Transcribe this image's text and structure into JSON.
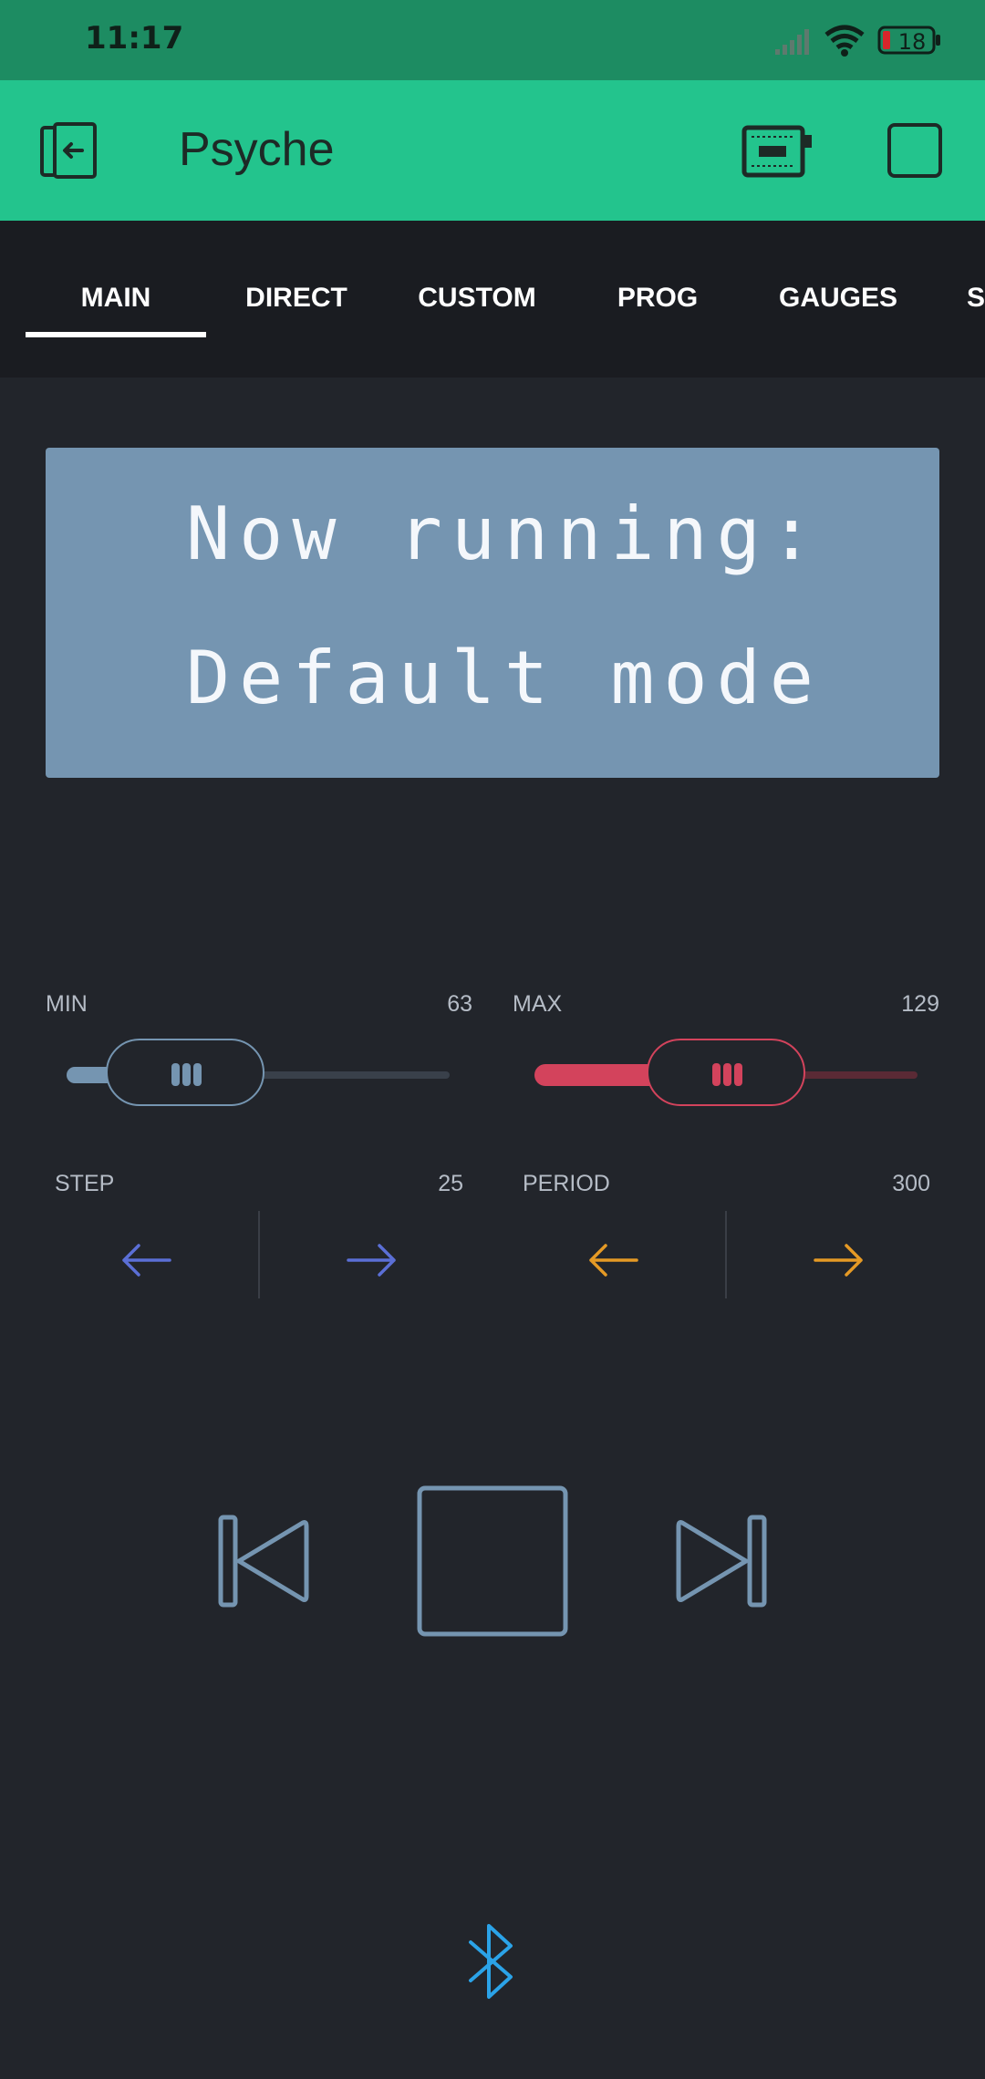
{
  "status_bar": {
    "time": "11:17",
    "battery": "18"
  },
  "app_bar": {
    "title": "Psyche"
  },
  "tabs": [
    {
      "label": "MAIN",
      "active": true
    },
    {
      "label": "DIRECT"
    },
    {
      "label": "CUSTOM"
    },
    {
      "label": "PROG"
    },
    {
      "label": "GAUGES"
    },
    {
      "label": "SE"
    }
  ],
  "lcd": {
    "line1": "Now running:",
    "line2": "Default mode"
  },
  "sliders": {
    "min": {
      "label": "MIN",
      "value": "63",
      "color": "#7595b1"
    },
    "max": {
      "label": "MAX",
      "value": "129",
      "color": "#d3435c"
    }
  },
  "steppers": {
    "step": {
      "label": "STEP",
      "value": "25",
      "color": "#5b6fd6"
    },
    "period": {
      "label": "PERIOD",
      "value": "300",
      "color": "#e59a25"
    }
  },
  "colors": {
    "accent": "#23c48d",
    "background": "#22252b",
    "media": "#7595b1",
    "bluetooth": "#2ba3e8"
  },
  "icons": {
    "back": "exit-door-icon",
    "device": "hardware-board-icon",
    "media_prev": "skip-previous-icon",
    "media_stop": "stop-icon",
    "media_next": "skip-next-icon",
    "bluetooth": "bluetooth-icon"
  }
}
